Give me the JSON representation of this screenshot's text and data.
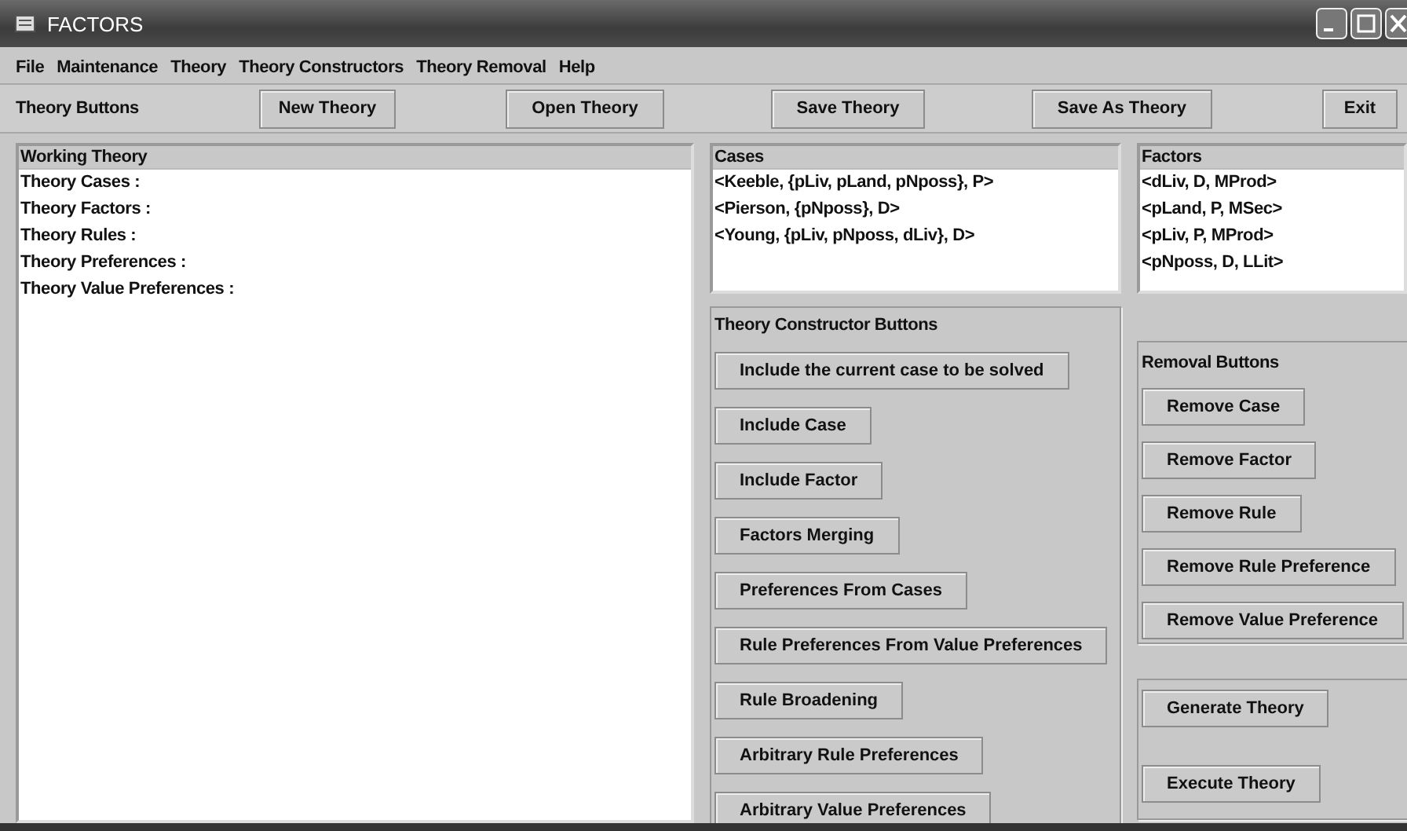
{
  "window": {
    "title": "FACTORS"
  },
  "menu": [
    "File",
    "Maintenance",
    "Theory",
    "Theory Constructors",
    "Theory Removal",
    "Help"
  ],
  "toolbar": {
    "label": "Theory Buttons",
    "buttons": [
      "New Theory",
      "Open Theory",
      "Save Theory",
      "Save As Theory",
      "Exit"
    ]
  },
  "working_theory": {
    "title": "Working Theory",
    "lines": [
      "Theory Cases :",
      "Theory Factors :",
      "Theory Rules :",
      "Theory Preferences :",
      "Theory Value Preferences :"
    ]
  },
  "cases": {
    "title": "Cases",
    "items": [
      "<Keeble, {pLiv, pLand, pNposs}, P>",
      "<Pierson, {pNposs}, D>",
      "<Young, {pLiv, pNposs, dLiv}, D>"
    ]
  },
  "factors": {
    "title": "Factors",
    "items": [
      "<dLiv, D, MProd>",
      "<pLand, P, MSec>",
      "<pLiv, P, MProd>",
      "<pNposs, D, LLit>"
    ]
  },
  "constructor_panel": {
    "title": "Theory Constructor Buttons",
    "buttons": [
      "Include the current case to be solved",
      "Include Case",
      "Include Factor",
      "Factors Merging",
      "Preferences From Cases",
      "Rule Preferences From Value Preferences",
      "Rule Broadening",
      "Arbitrary Rule Preferences",
      "Arbitrary Value Preferences"
    ]
  },
  "removal_panel": {
    "title": "Removal Buttons",
    "buttons": [
      "Remove Case",
      "Remove Factor",
      "Remove Rule",
      "Remove Rule Preference",
      "Remove Value Preference"
    ]
  },
  "theory_panel": {
    "buttons": [
      "Generate Theory",
      "Execute Theory"
    ]
  }
}
